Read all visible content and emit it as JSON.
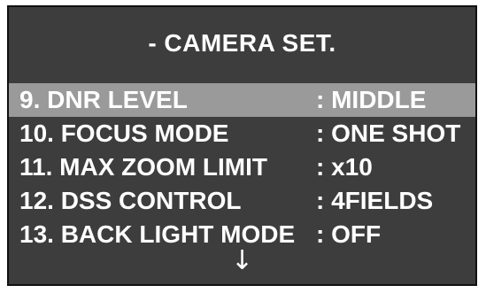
{
  "osd": {
    "title": "- CAMERA SET.",
    "items": [
      {
        "label": "9. DNR LEVEL",
        "value": ": MIDDLE",
        "selected": true
      },
      {
        "label": "10. FOCUS MODE",
        "value": ": ONE SHOT",
        "selected": false
      },
      {
        "label": "11. MAX ZOOM LIMIT",
        "value": ": x10",
        "selected": false
      },
      {
        "label": "12. DSS CONTROL",
        "value": ": 4FIELDS",
        "selected": false
      },
      {
        "label": "13. BACK LIGHT MODE",
        "value": ": OFF",
        "selected": false
      }
    ],
    "scroll_indicator": "↓",
    "scroll_indicator_icon": "arrow-down-icon"
  },
  "colors": {
    "background": "#3d3d3d",
    "highlight": "#9a9a9a",
    "text": "#ffffff",
    "border": "#111111"
  }
}
